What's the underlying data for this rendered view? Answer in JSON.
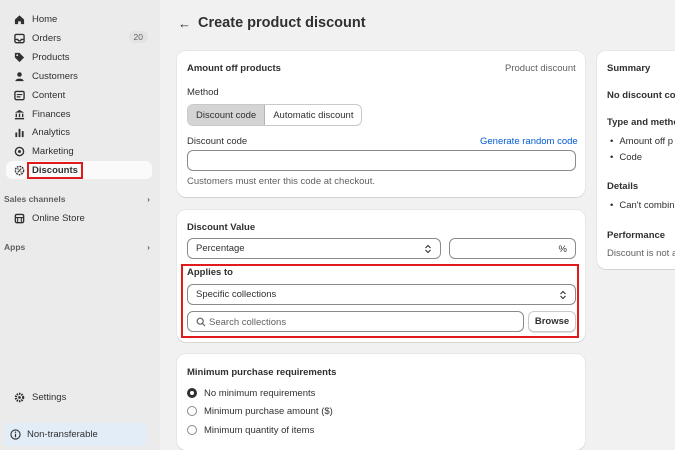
{
  "sidebar": {
    "items": [
      {
        "label": "Home",
        "icon": "home-icon"
      },
      {
        "label": "Orders",
        "icon": "inbox-icon",
        "badge": "20"
      },
      {
        "label": "Products",
        "icon": "tag-icon"
      },
      {
        "label": "Customers",
        "icon": "person-icon"
      },
      {
        "label": "Content",
        "icon": "content-icon"
      },
      {
        "label": "Finances",
        "icon": "bank-icon"
      },
      {
        "label": "Analytics",
        "icon": "bar-chart-icon"
      },
      {
        "label": "Marketing",
        "icon": "target-icon"
      },
      {
        "label": "Discounts",
        "icon": "discount-gear-icon"
      }
    ],
    "sales_channels_label": "Sales channels",
    "online_store_label": "Online Store",
    "apps_label": "Apps",
    "settings_label": "Settings",
    "banner_label": "Non-transferable"
  },
  "header": {
    "back_glyph": "←",
    "title": "Create product discount"
  },
  "method_card": {
    "title": "Amount off products",
    "type_label": "Product discount",
    "method_label": "Method",
    "seg_discount_code": "Discount code",
    "seg_automatic": "Automatic discount",
    "code_label": "Discount code",
    "generate_link": "Generate random code",
    "code_value": "",
    "help_text": "Customers must enter this code at checkout."
  },
  "value_card": {
    "title": "Discount Value",
    "value_type": "Percentage",
    "percent_suffix": "%",
    "applies_label": "Applies to",
    "applies_value": "Specific collections",
    "search_placeholder": "Search collections",
    "browse_label": "Browse"
  },
  "requirements_card": {
    "title": "Minimum purchase requirements",
    "options": [
      "No minimum requirements",
      "Minimum purchase amount ($)",
      "Minimum quantity of items"
    ],
    "selected_index": 0
  },
  "summary_card": {
    "title": "Summary",
    "no_code": "No discount cod",
    "type_heading": "Type and metho",
    "type_items": [
      "Amount off p",
      "Code"
    ],
    "details_heading": "Details",
    "details_items": [
      "Can't combin"
    ],
    "performance_heading": "Performance",
    "performance_text": "Discount is not a"
  },
  "colors": {
    "highlight": "#e01b1b",
    "link": "#005bd3",
    "sidebar_bg": "#ebebeb"
  }
}
